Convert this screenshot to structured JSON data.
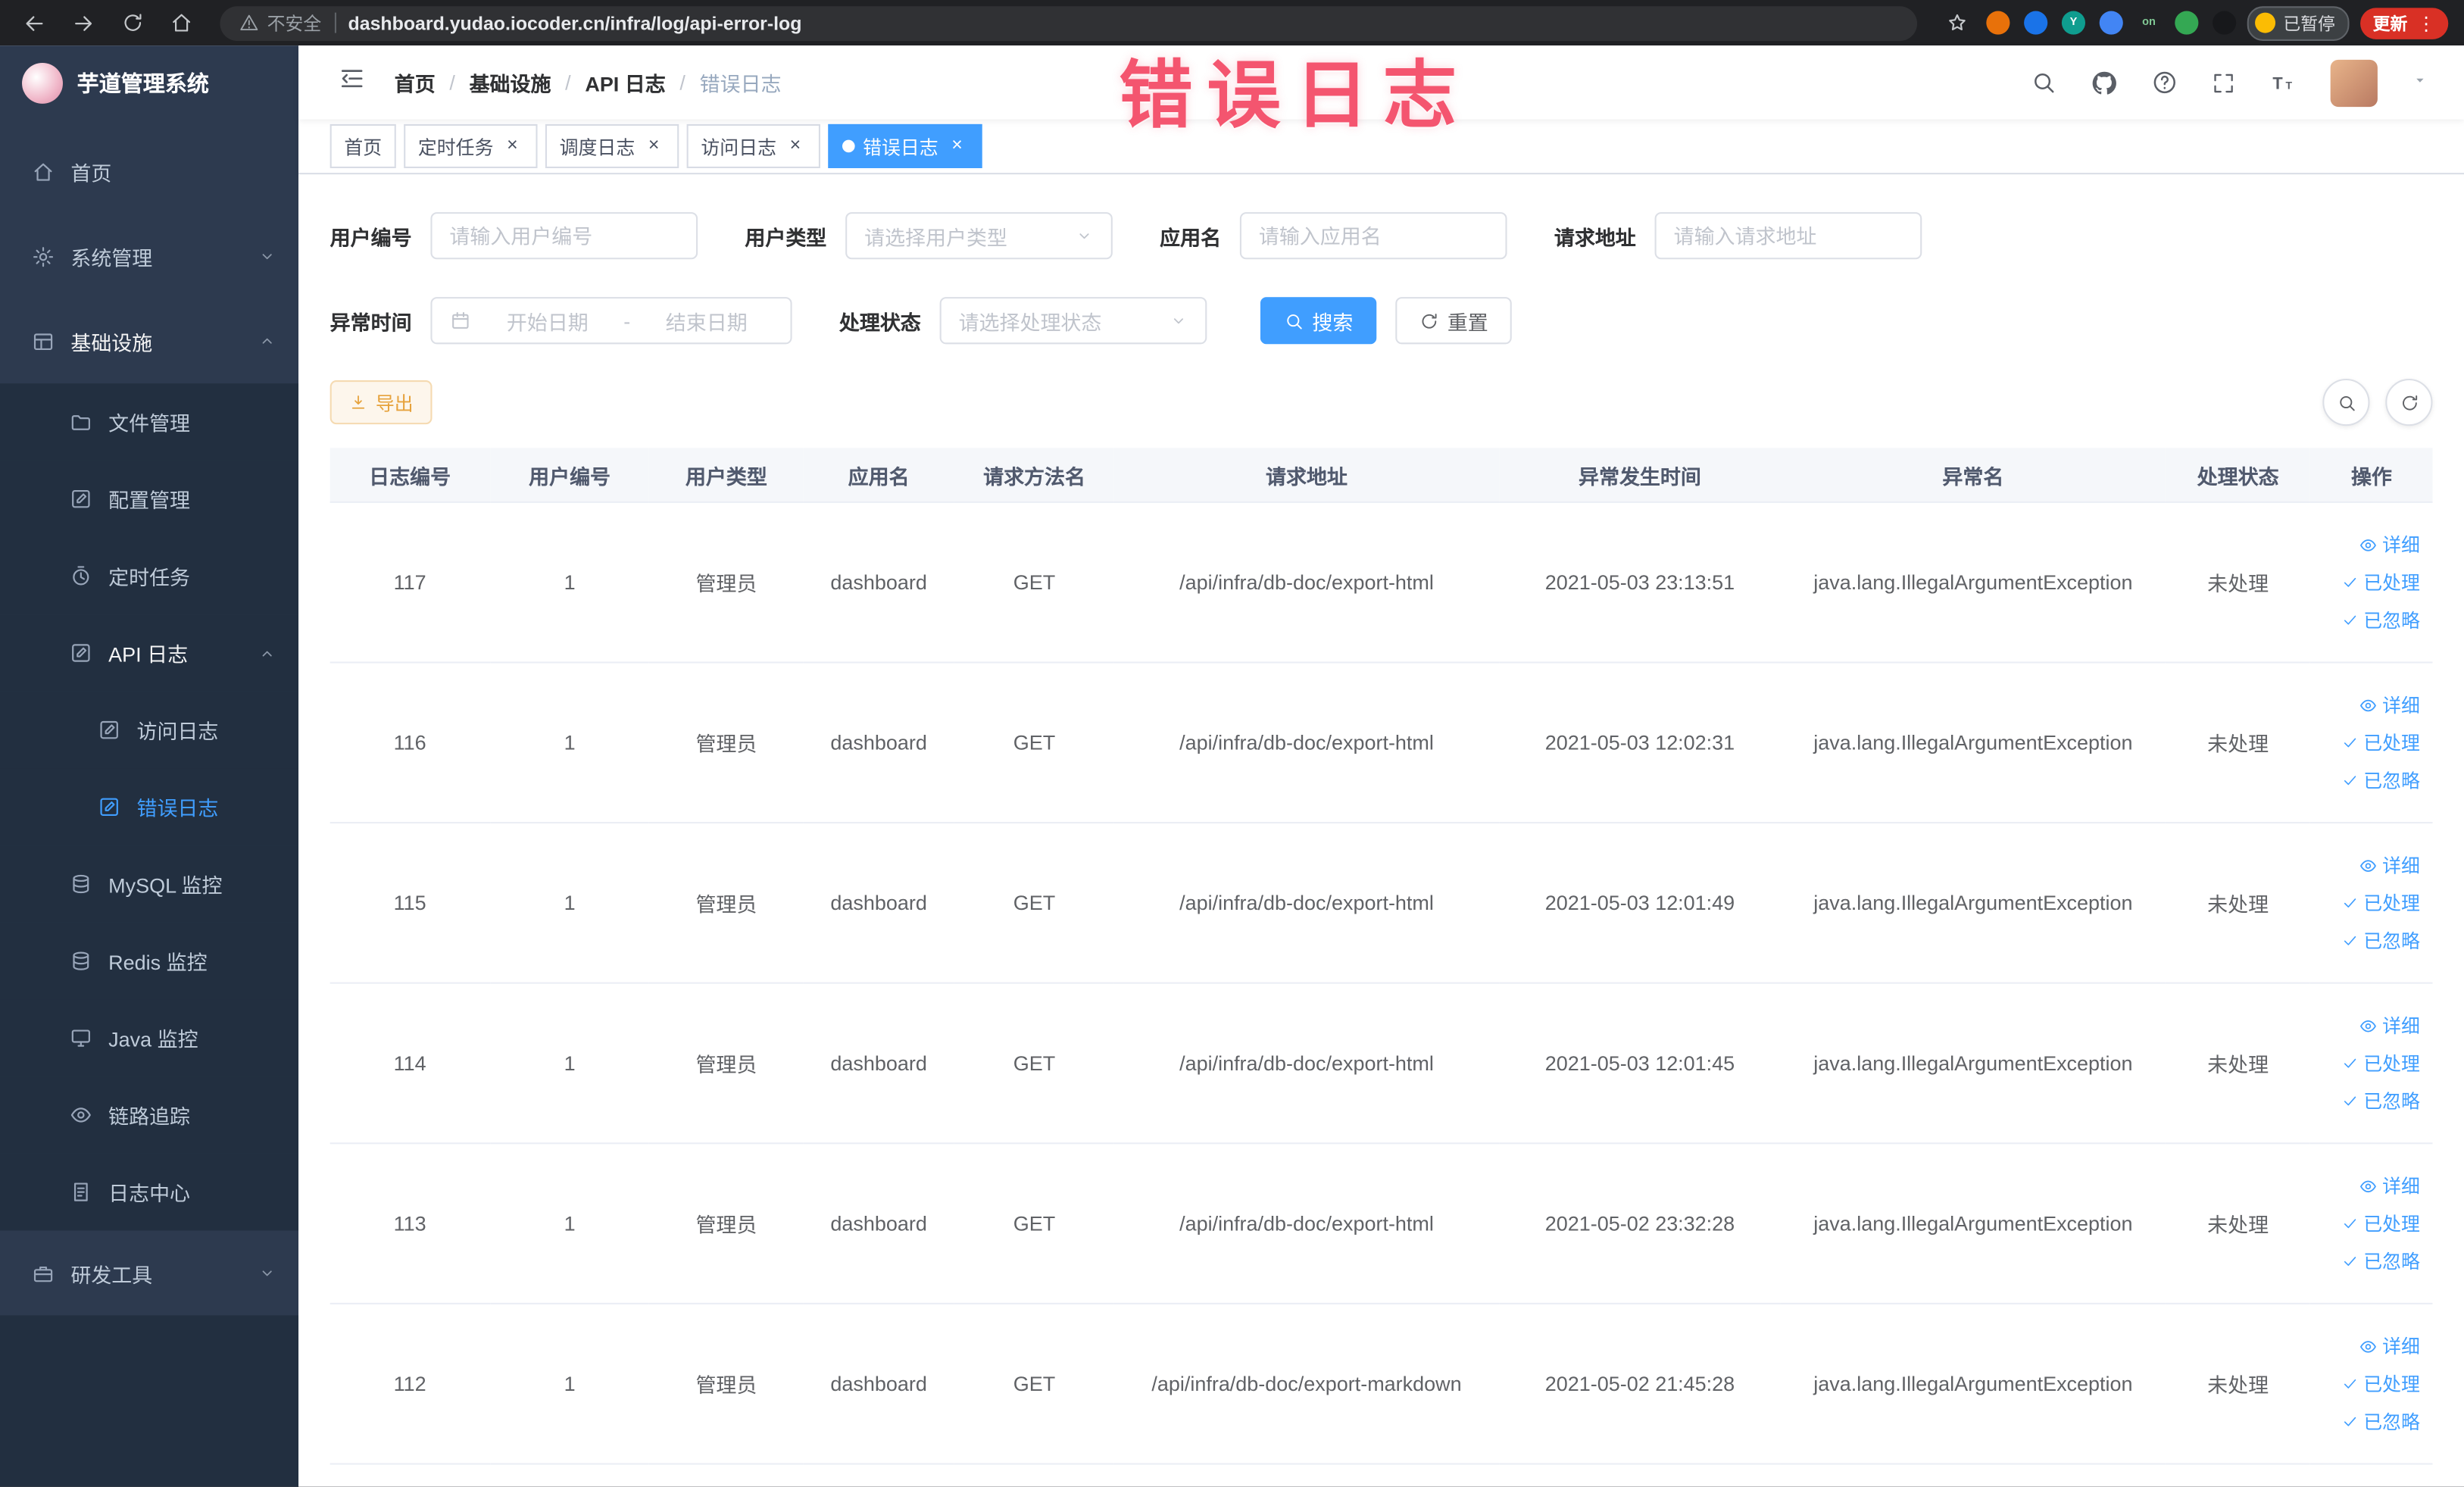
{
  "browser": {
    "security_warning": "不安全",
    "url": "dashboard.yudao.iocoder.cn/infra/log/api-error-log",
    "paused_badge": "已暂停",
    "update_label": "更新",
    "kebab": "⋮",
    "extensions": [
      {
        "key": "ext-1",
        "color": "#e8710a",
        "text": ""
      },
      {
        "key": "ext-2",
        "color": "#1a73e8",
        "text": ""
      },
      {
        "key": "ext-3",
        "color": "#0f9d8f",
        "text": "Y",
        "text_color": "#ffffff"
      },
      {
        "key": "ext-4",
        "color": "#4285f4",
        "text": ""
      },
      {
        "key": "ext-5",
        "color": "#202124",
        "text": "on",
        "text_color": "#81c995"
      },
      {
        "key": "ext-6",
        "color": "#34a853",
        "text": ""
      },
      {
        "key": "ext-7",
        "color": "#17181b",
        "text": ""
      }
    ]
  },
  "sidebar": {
    "logo_title": "芋道管理系统",
    "items": [
      {
        "key": "home",
        "label": "首页",
        "icon": "home-icon",
        "level": 0
      },
      {
        "key": "system-management",
        "label": "系统管理",
        "icon": "gear-icon",
        "level": 0,
        "chevron": "down"
      },
      {
        "key": "infrastructure",
        "label": "基础设施",
        "icon": "layout-icon",
        "level": 0,
        "chevron": "up",
        "open": true
      },
      {
        "key": "file-management",
        "label": "文件管理",
        "icon": "folder-icon",
        "level": 1
      },
      {
        "key": "config-management",
        "label": "配置管理",
        "icon": "edit-icon",
        "level": 1
      },
      {
        "key": "scheduled-tasks",
        "label": "定时任务",
        "icon": "timer-icon",
        "level": 1
      },
      {
        "key": "api-log",
        "label": "API 日志",
        "icon": "edit-icon",
        "level": 1,
        "chevron": "up",
        "open": true
      },
      {
        "key": "access-log",
        "label": "访问日志",
        "icon": "edit-icon",
        "level": 2
      },
      {
        "key": "error-log",
        "label": "错误日志",
        "icon": "edit-icon",
        "level": 2,
        "active": true
      },
      {
        "key": "mysql-monitor",
        "label": "MySQL 监控",
        "icon": "database-icon",
        "level": 1
      },
      {
        "key": "redis-monitor",
        "label": "Redis 监控",
        "icon": "database-icon",
        "level": 1
      },
      {
        "key": "java-monitor",
        "label": "Java 监控",
        "icon": "monitor-icon",
        "level": 1
      },
      {
        "key": "trace",
        "label": "链路追踪",
        "icon": "eye-icon",
        "level": 1
      },
      {
        "key": "log-center",
        "label": "日志中心",
        "icon": "document-icon",
        "level": 1
      },
      {
        "key": "dev-tools",
        "label": "研发工具",
        "icon": "toolbox-icon",
        "level": 0,
        "chevron": "down"
      }
    ]
  },
  "navbar": {
    "breadcrumb": [
      {
        "label": "首页"
      },
      {
        "label": "基础设施"
      },
      {
        "label": "API 日志"
      },
      {
        "label": "错误日志"
      }
    ],
    "breadcrumb_separator": "/"
  },
  "annotation": {
    "text": "错误日志",
    "color": "#f4556f"
  },
  "tags_view": {
    "tabs": [
      {
        "key": "home",
        "label": "首页",
        "closable": false,
        "active": false
      },
      {
        "key": "scheduled-tasks",
        "label": "定时任务",
        "closable": true,
        "active": false
      },
      {
        "key": "schedule-log",
        "label": "调度日志",
        "closable": true,
        "active": false
      },
      {
        "key": "access-log",
        "label": "访问日志",
        "closable": true,
        "active": false
      },
      {
        "key": "error-log",
        "label": "错误日志",
        "closable": true,
        "active": true
      }
    ],
    "close_glyph": "×"
  },
  "filters": {
    "user_id": {
      "label": "用户编号",
      "placeholder": "请输入用户编号"
    },
    "user_type": {
      "label": "用户类型",
      "placeholder": "请选择用户类型"
    },
    "app_name": {
      "label": "应用名",
      "placeholder": "请输入应用名"
    },
    "request_url": {
      "label": "请求地址",
      "placeholder": "请输入请求地址"
    },
    "exception_time": {
      "label": "异常时间",
      "start_placeholder": "开始日期",
      "separator": "-",
      "end_placeholder": "结束日期"
    },
    "process_status": {
      "label": "处理状态",
      "placeholder": "请选择处理状态"
    },
    "search_label": "搜索",
    "reset_label": "重置"
  },
  "toolbar": {
    "export_label": "导出"
  },
  "table": {
    "columns": [
      "日志编号",
      "用户编号",
      "用户类型",
      "应用名",
      "请求方法名",
      "请求地址",
      "异常发生时间",
      "异常名",
      "处理状态",
      "操作"
    ],
    "row_actions": [
      "详细",
      "已处理",
      "已忽略"
    ],
    "rows": [
      {
        "id": "117",
        "user_id": "1",
        "user_type": "管理员",
        "app": "dashboard",
        "method": "GET",
        "url": "/api/infra/db-doc/export-html",
        "time": "2021-05-03 23:13:51",
        "exception": "java.lang.IllegalArgumentException",
        "status": "未处理"
      },
      {
        "id": "116",
        "user_id": "1",
        "user_type": "管理员",
        "app": "dashboard",
        "method": "GET",
        "url": "/api/infra/db-doc/export-html",
        "time": "2021-05-03 12:02:31",
        "exception": "java.lang.IllegalArgumentException",
        "status": "未处理"
      },
      {
        "id": "115",
        "user_id": "1",
        "user_type": "管理员",
        "app": "dashboard",
        "method": "GET",
        "url": "/api/infra/db-doc/export-html",
        "time": "2021-05-03 12:01:49",
        "exception": "java.lang.IllegalArgumentException",
        "status": "未处理"
      },
      {
        "id": "114",
        "user_id": "1",
        "user_type": "管理员",
        "app": "dashboard",
        "method": "GET",
        "url": "/api/infra/db-doc/export-html",
        "time": "2021-05-03 12:01:45",
        "exception": "java.lang.IllegalArgumentException",
        "status": "未处理"
      },
      {
        "id": "113",
        "user_id": "1",
        "user_type": "管理员",
        "app": "dashboard",
        "method": "GET",
        "url": "/api/infra/db-doc/export-html",
        "time": "2021-05-02 23:32:28",
        "exception": "java.lang.IllegalArgumentException",
        "status": "未处理"
      },
      {
        "id": "112",
        "user_id": "1",
        "user_type": "管理员",
        "app": "dashboard",
        "method": "GET",
        "url": "/api/infra/db-doc/export-markdown",
        "time": "2021-05-02 21:45:28",
        "exception": "java.lang.IllegalArgumentException",
        "status": "未处理"
      }
    ]
  },
  "colors": {
    "primary": "#409eff",
    "warning": "#e6a23c",
    "sidebar_bg": "#2d3a4f",
    "submenu_bg": "#222f40"
  }
}
